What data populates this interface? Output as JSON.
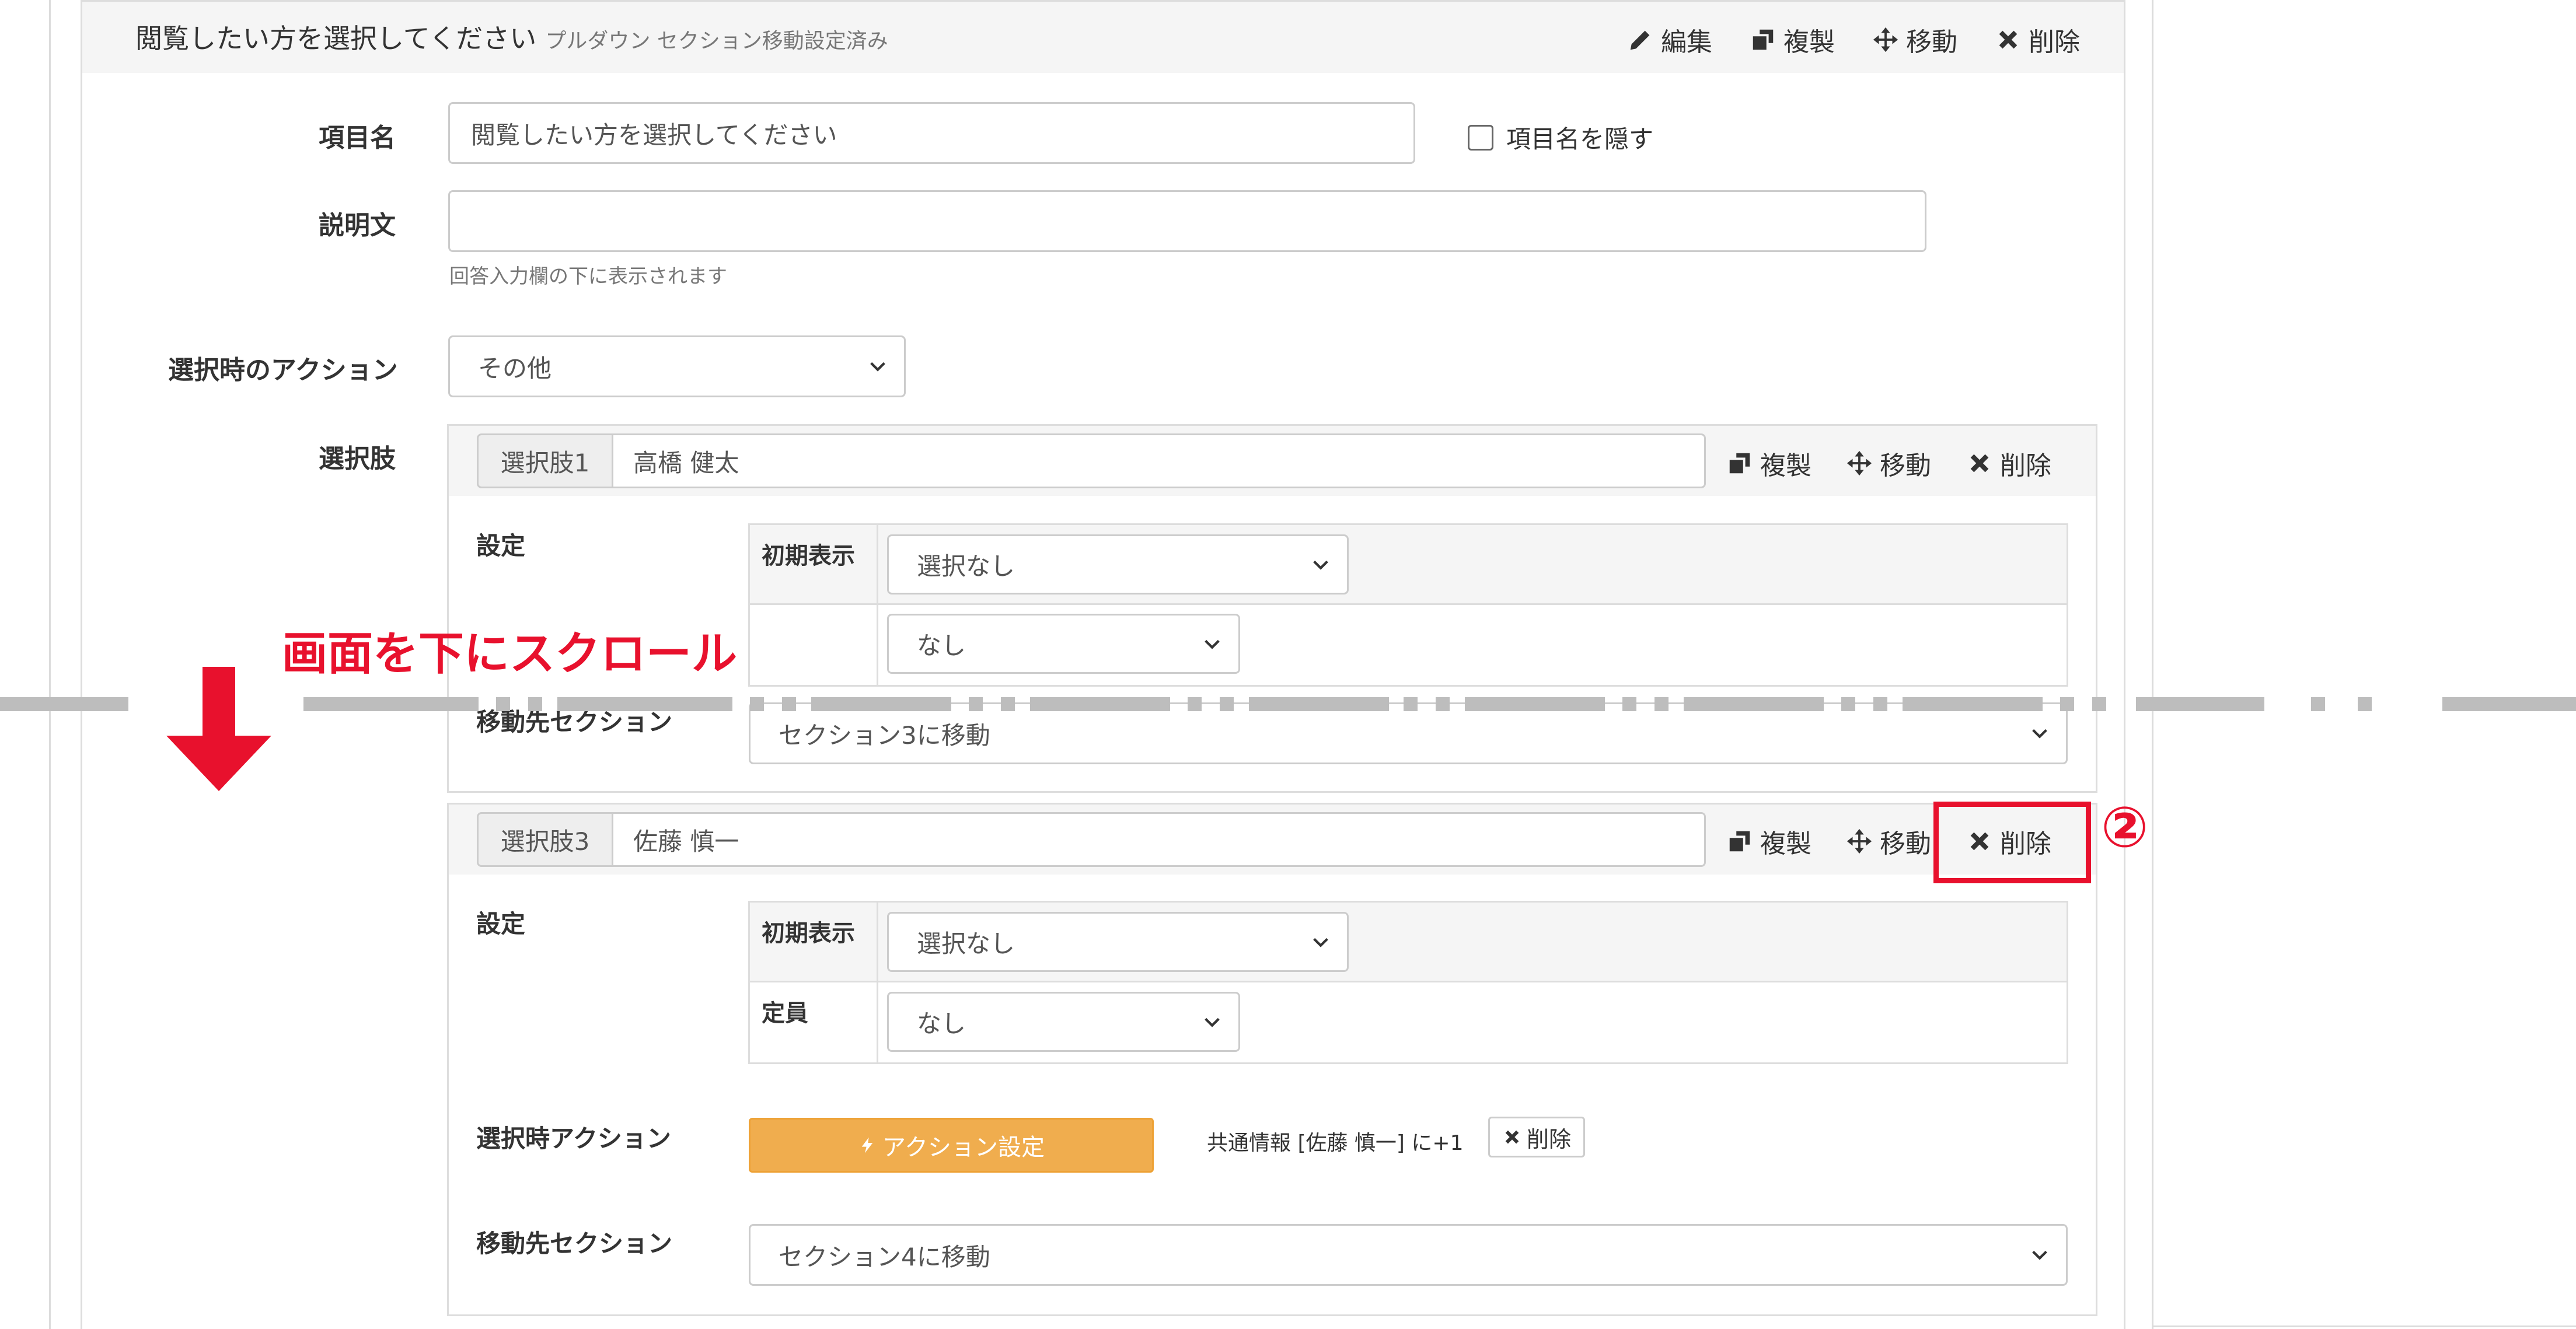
{
  "header": {
    "title": "閲覧したい方を選択してください",
    "subtitle": "プルダウン セクション移動設定済み",
    "actions": {
      "edit": "編集",
      "copy": "複製",
      "move": "移動",
      "delete": "削除"
    }
  },
  "fields": {
    "item_name": {
      "label": "項目名",
      "value": "閲覧したい方を選択してください",
      "hide_label": "項目名を隠す"
    },
    "description": {
      "label": "説明文",
      "value": "",
      "help": "回答入力欄の下に表示されます"
    },
    "select_action": {
      "label": "選択時のアクション",
      "value": "その他"
    },
    "choices_label": "選択肢"
  },
  "choice1": {
    "addon": "選択肢1",
    "value": "高橋 健太",
    "actions": {
      "copy": "複製",
      "move": "移動",
      "delete": "削除"
    },
    "settings_label": "設定",
    "initial_label": "初期表示",
    "initial_value": "選択なし",
    "capacity_value": "なし",
    "dest_label": "移動先セクション",
    "dest_value": "セクション3に移動"
  },
  "choice3": {
    "addon": "選択肢3",
    "value": "佐藤 慎一",
    "actions": {
      "copy": "複製",
      "move": "移動",
      "delete": "削除"
    },
    "settings_label": "設定",
    "initial_label": "初期表示",
    "initial_value": "選択なし",
    "capacity_label": "定員",
    "capacity_value": "なし",
    "action_label": "選択時アクション",
    "action_button": "アクション設定",
    "action_summary": "共通情報 [佐藤 慎一] に+1",
    "action_delete": "削除",
    "dest_label": "移動先セクション",
    "dest_value": "セクション4に移動"
  },
  "annotations": {
    "scroll_text": "画面を下にスクロール",
    "step_marker": "②",
    "red": "#e8112d"
  },
  "colors": {
    "orange": "#f0ad4e",
    "panel_bg": "#f5f5f5",
    "border": "#cccccc"
  }
}
